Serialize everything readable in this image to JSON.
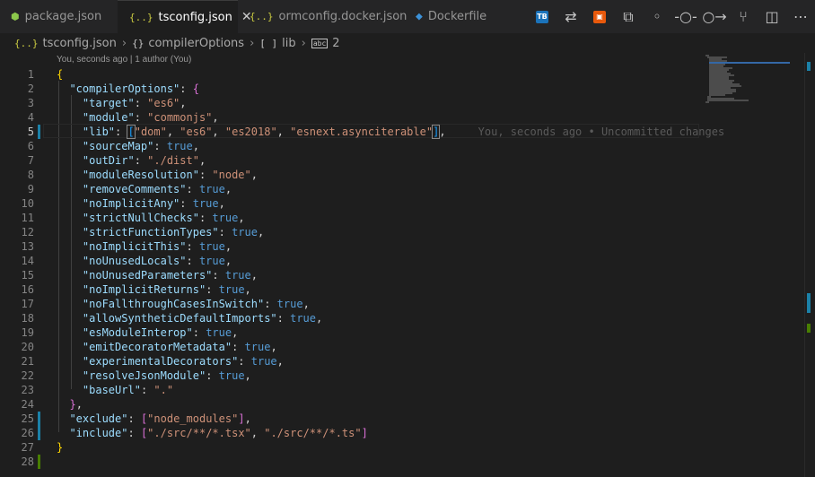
{
  "tabs": [
    {
      "icon_name": "nodejs-icon",
      "icon_text": "JS",
      "label": "package.json",
      "active": false
    },
    {
      "icon_name": "json-icon",
      "icon_text": "{..}",
      "label": "tsconfig.json",
      "active": true
    },
    {
      "icon_name": "json-icon",
      "icon_text": "{..}",
      "label": "ormconfig.docker.json",
      "active": false
    },
    {
      "icon_name": "docker-icon",
      "icon_text": "🐳",
      "label": "Dockerfile",
      "active": false
    }
  ],
  "breadcrumb": {
    "file_icon": "{..}",
    "file": "tsconfig.json",
    "obj_icon": "{}",
    "obj": "compilerOptions",
    "arr_icon": "[ ]",
    "arr": "lib",
    "idx_icon": "abc",
    "idx": "2"
  },
  "codelens": "You, seconds ago | 1 author (You)",
  "blame": "You, seconds ago • Uncommitted changes",
  "current_line": 5,
  "code": {
    "compilerOptions": "\"compilerOptions\"",
    "target": "\"target\"",
    "target_v": "\"es6\"",
    "module": "\"module\"",
    "module_v": "\"commonjs\"",
    "lib": "\"lib\"",
    "lib_v1": "\"dom\"",
    "lib_v2": "\"es6\"",
    "lib_v3": "\"es2018\"",
    "lib_v4": "\"esnext.asynciterable\"",
    "sourceMap": "\"sourceMap\"",
    "outDir": "\"outDir\"",
    "outDir_v": "\"./dist\"",
    "moduleResolution": "\"moduleResolution\"",
    "moduleResolution_v": "\"node\"",
    "removeComments": "\"removeComments\"",
    "noImplicitAny": "\"noImplicitAny\"",
    "strictNullChecks": "\"strictNullChecks\"",
    "strictFunctionTypes": "\"strictFunctionTypes\"",
    "noImplicitThis": "\"noImplicitThis\"",
    "noUnusedLocals": "\"noUnusedLocals\"",
    "noUnusedParameters": "\"noUnusedParameters\"",
    "noImplicitReturns": "\"noImplicitReturns\"",
    "noFallthroughCasesInSwitch": "\"noFallthroughCasesInSwitch\"",
    "allowSyntheticDefaultImports": "\"allowSyntheticDefaultImports\"",
    "esModuleInterop": "\"esModuleInterop\"",
    "emitDecoratorMetadata": "\"emitDecoratorMetadata\"",
    "experimentalDecorators": "\"experimentalDecorators\"",
    "resolveJsonModule": "\"resolveJsonModule\"",
    "baseUrl": "\"baseUrl\"",
    "baseUrl_v": "\".\"",
    "exclude": "\"exclude\"",
    "exclude_v": "\"node_modules\"",
    "include": "\"include\"",
    "include_v1": "\"./src/**/*.tsx\"",
    "include_v2": "\"./src/**/*.ts\"",
    "true_kw": "true"
  },
  "colors": {
    "accent": "#007acc",
    "modified": "#1b81a8",
    "added": "#487e02"
  }
}
